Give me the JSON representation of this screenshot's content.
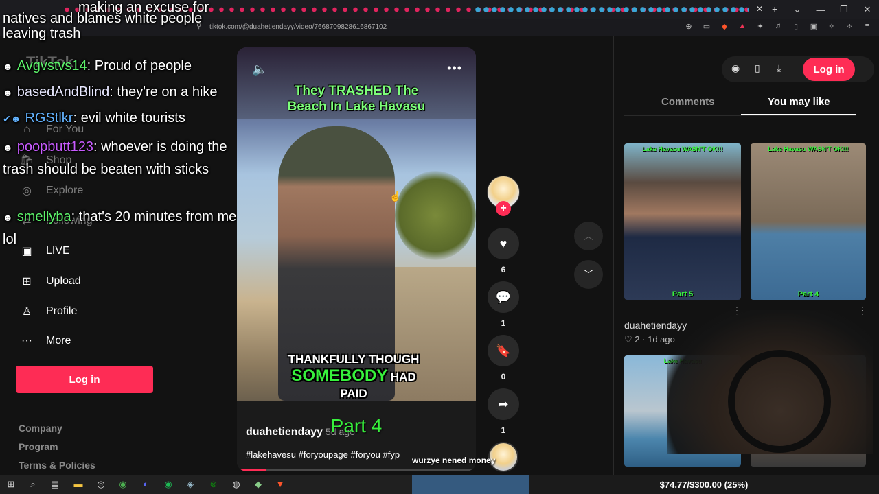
{
  "browser": {
    "url": "tiktok.com/@duahetiendayy/video/7668709828616867102"
  },
  "nav": {
    "logo": "TikTok",
    "items": [
      {
        "label": "For You",
        "icon": "home-icon"
      },
      {
        "label": "Shop",
        "icon": "shop-icon"
      },
      {
        "label": "Explore",
        "icon": "explore-icon"
      },
      {
        "label": "Following",
        "icon": "following-icon"
      },
      {
        "label": "LIVE",
        "icon": "live-icon"
      },
      {
        "label": "Upload",
        "icon": "upload-icon"
      },
      {
        "label": "Profile",
        "icon": "profile-icon"
      },
      {
        "label": "More",
        "icon": "more-icon"
      }
    ],
    "login": "Log in",
    "footer": [
      "Company",
      "Program",
      "Terms & Policies"
    ]
  },
  "chat": {
    "lines": [
      {
        "user": "",
        "text": "natives and blames white people leaving trash"
      },
      {
        "user": "Avgvstvs14",
        "text": ": Proud of people"
      },
      {
        "user": "basedAndBlind",
        "text": ": they're on a hike"
      },
      {
        "user": "RGStlkr",
        "text": ": evil white tourists"
      },
      {
        "user": "poopbutt123",
        "text": ": whoever is doing the trash should be beaten with sticks"
      },
      {
        "user": "smellyba",
        "text": ": that's 20 minutes from me lol"
      }
    ],
    "header_fragment": "making an excuse for"
  },
  "video": {
    "top_caption_1": "They TRASHED The",
    "top_caption_2": "Beach In Lake Havasu",
    "sub_1": "THANKFULLY THOUGH",
    "sub_2a": "SOMEBODY",
    "sub_2b": "HAD",
    "sub_3": "PAID",
    "part": "Part 4",
    "author": "duahetiendayy",
    "age": "5d ago",
    "tags": "#lakehavesu #foryoupage #foryou #fyp",
    "music": "wurzye nened money",
    "progress": 0.12
  },
  "actions": {
    "likes": "6",
    "comments": "1",
    "saves": "0",
    "shares": "1"
  },
  "right": {
    "login": "Log in",
    "tabs": [
      "Comments",
      "You may like"
    ],
    "thumbs": [
      {
        "caption": "Lake Havasu WASN'T OK!!!",
        "part": "Part 5"
      },
      {
        "caption": "Lake Havasu WASN'T OK!!!",
        "part": "Part 4"
      },
      {
        "caption": "Lake Havasu",
        "part": ""
      },
      {
        "caption": "",
        "part": ""
      }
    ],
    "meta_author": "duahetiendayy",
    "meta_likes": "2",
    "meta_age": "1d ago"
  },
  "taskbar": {
    "goal": "$74.77/$300.00 (25%)"
  }
}
